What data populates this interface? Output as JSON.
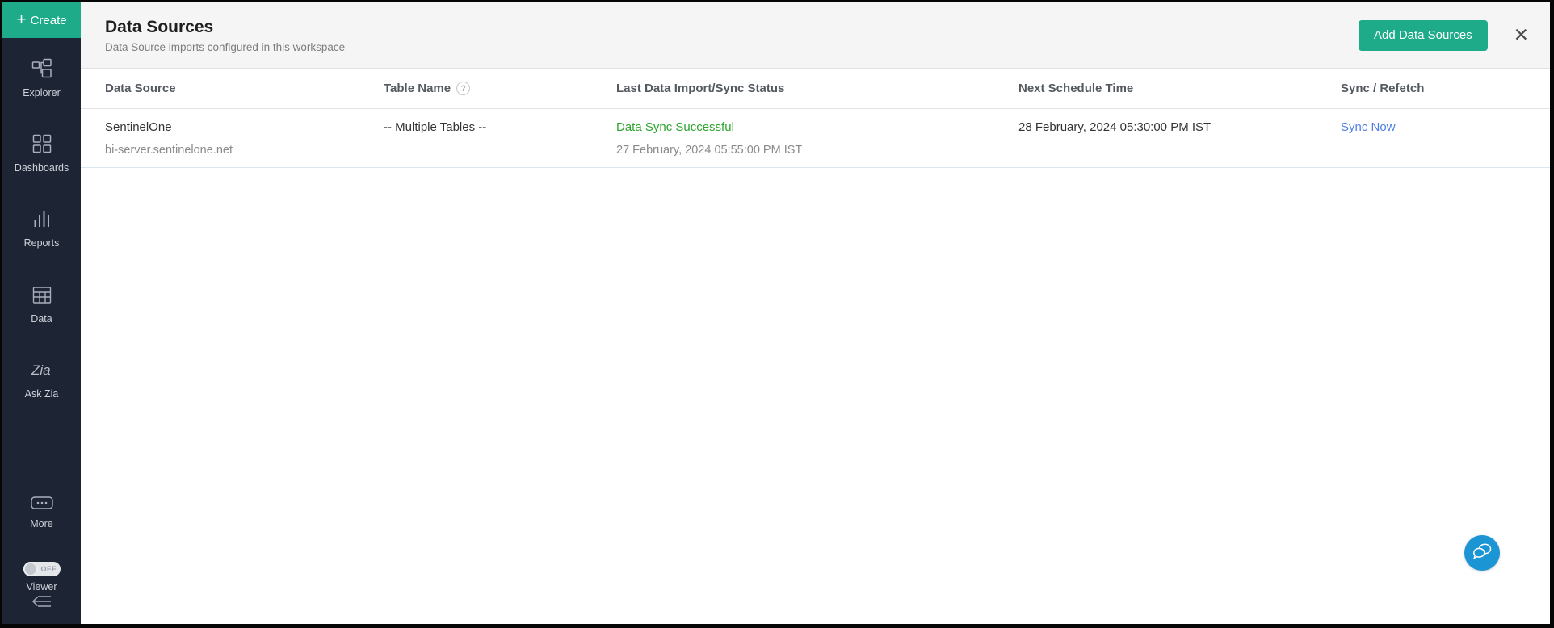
{
  "icons": {
    "plus": "+",
    "close": "✕",
    "help": "?",
    "zia": "Zia"
  },
  "colors": {
    "accent_green": "#1dab89",
    "status_green": "#2da42d",
    "link_blue": "#4f7fe4",
    "sidebar_bg": "#1d2433",
    "chat_blue": "#1c95d4"
  },
  "sidebar": {
    "create_label": "Create",
    "items": [
      {
        "id": "explorer",
        "label": "Explorer"
      },
      {
        "id": "dashboards",
        "label": "Dashboards"
      },
      {
        "id": "reports",
        "label": "Reports"
      },
      {
        "id": "data",
        "label": "Data"
      },
      {
        "id": "ask-zia",
        "label": "Ask Zia"
      },
      {
        "id": "more",
        "label": "More"
      }
    ],
    "viewer": {
      "label": "Viewer",
      "state": "OFF"
    }
  },
  "header": {
    "title": "Data Sources",
    "subtitle": "Data Source imports configured in this workspace",
    "add_button_label": "Add Data Sources"
  },
  "table": {
    "columns": [
      "Data Source",
      "Table Name",
      "Last Data Import/Sync Status",
      "Next Schedule Time",
      "Sync / Refetch"
    ],
    "rows": [
      {
        "name": "SentinelOne",
        "server": "bi-server.sentinelone.net",
        "table_name": "-- Multiple Tables --",
        "status": "Data Sync Successful",
        "status_time": "27 February, 2024 05:55:00 PM IST",
        "next_schedule": "28 February, 2024 05:30:00 PM IST",
        "action": "Sync Now"
      }
    ]
  }
}
